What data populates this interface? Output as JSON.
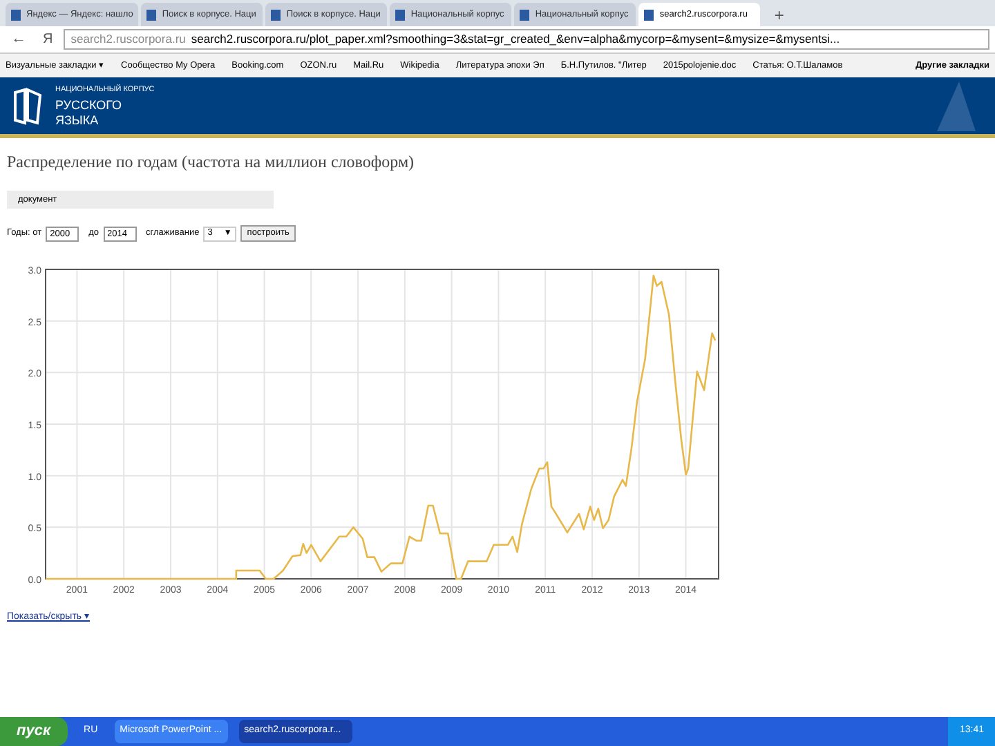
{
  "browser": {
    "tabs": [
      {
        "label": "Яндекс — Яндекс: нашло",
        "selected": false
      },
      {
        "label": "Поиск в корпусе. Наци",
        "selected": false
      },
      {
        "label": "Поиск в корпусе. Наци",
        "selected": false
      },
      {
        "label": "Национальный корпус",
        "selected": false
      },
      {
        "label": "Национальный корпус",
        "selected": false
      },
      {
        "label": "search2.ruscorpora.ru",
        "selected": true
      }
    ],
    "new_tab": "+",
    "back": "←",
    "yandex": "Я",
    "address": {
      "host": "search2.ruscorpora.ru",
      "url": "search2.ruscorpora.ru/plot_paper.xml?smoothing=3&stat=gr_created_&env=alpha&mycorp=&mysent=&mysize=&mysentsi..."
    },
    "bookmarks": [
      "Визуальные закладки ▾",
      "Сообщество My Opera",
      "Booking.com",
      "OZON.ru",
      "Mail.Ru",
      "Wikipedia",
      "Литература эпохи Эп",
      "Б.Н.Путилов. \"Литер",
      "2015polojenie.doc",
      "Статья: О.Т.Шаламов"
    ],
    "other_bookmarks": "Другие закладки"
  },
  "header": {
    "logo_lines": [
      "НАЦИОНАЛЬНЫЙ КОРПУС",
      "РУССКОГО",
      "ЯЗЫКА"
    ]
  },
  "page": {
    "title": "Распределение по годам (частота на миллион словоформ)",
    "section": "документ",
    "form": {
      "years_label": "Годы: от",
      "from": "2000",
      "to_label": "до",
      "to": "2014",
      "smoothing_label": "сглаживание",
      "smoothing": "3",
      "smoothing_caret": "▼",
      "submit": "построить"
    },
    "chart_data": {
      "type": "line",
      "xticks": [
        2001,
        2002,
        2003,
        2004,
        2005,
        2006,
        2007,
        2008,
        2009,
        2010,
        2011,
        2012,
        2013,
        2014
      ],
      "yticks": [
        {
          "value": 0,
          "label": "0.0"
        },
        0.5,
        {
          "value": 1,
          "label": "1.0"
        },
        1.5,
        {
          "value": 2,
          "label": "2.0"
        },
        2.5,
        {
          "value": 3,
          "label": "3.0"
        }
      ],
      "grid": true,
      "xlim": [
        2000.33,
        2014.7
      ],
      "ylim": [
        0,
        3
      ],
      "x": [
        2000.33,
        2004.4,
        2004.4,
        2004.9,
        2005.03,
        2005.2,
        2005.4,
        2005.6,
        2005.77,
        2005.83,
        2005.9,
        2006.0,
        2006.2,
        2006.6,
        2006.75,
        2006.9,
        2007.1,
        2007.2,
        2007.35,
        2007.5,
        2007.7,
        2007.95,
        2008.1,
        2008.25,
        2008.35,
        2008.5,
        2008.6,
        2008.75,
        2008.92,
        2009.1,
        2009.2,
        2009.35,
        2009.75,
        2009.9,
        2010.2,
        2010.3,
        2010.4,
        2010.5,
        2010.7,
        2010.87,
        2010.96,
        2011.04,
        2011.13,
        2011.23,
        2011.47,
        2011.72,
        2011.82,
        2011.96,
        2012.04,
        2012.13,
        2012.23,
        2012.35,
        2012.47,
        2012.65,
        2012.72,
        2012.84,
        2012.96,
        2013.13,
        2013.31,
        2013.38,
        2013.48,
        2013.64,
        2013.77,
        2013.9,
        2014.0,
        2014.05,
        2014.24,
        2014.39,
        2014.56,
        2014.63
      ],
      "series": [
        {
          "color": "#e8b84a",
          "values": [
            0,
            0,
            0.08,
            0.08,
            0,
            0,
            0.08,
            0.22,
            0.23,
            0.34,
            0.25,
            0.33,
            0.17,
            0.41,
            0.41,
            0.5,
            0.39,
            0.21,
            0.21,
            0.07,
            0.15,
            0.15,
            0.41,
            0.37,
            0.37,
            0.71,
            0.71,
            0.44,
            0.44,
            0,
            0,
            0.17,
            0.17,
            0.33,
            0.33,
            0.41,
            0.26,
            0.53,
            0.87,
            1.07,
            1.07,
            1.13,
            0.7,
            0.63,
            0.45,
            0.63,
            0.48,
            0.7,
            0.57,
            0.68,
            0.49,
            0.57,
            0.8,
            0.96,
            0.9,
            1.27,
            1.72,
            2.13,
            2.94,
            2.84,
            2.88,
            2.56,
            1.93,
            1.36,
            1.01,
            1.07,
            2.01,
            1.83,
            2.38,
            2.31
          ]
        }
      ]
    },
    "toggle_link": "Показать/скрыть ▾"
  },
  "taskbar": {
    "start": "пуск",
    "lang": "RU",
    "tasks": [
      {
        "label": "Microsoft PowerPoint ...",
        "selected": false
      },
      {
        "label": "search2.ruscorpora.r...",
        "selected": true
      }
    ],
    "time": "13:41"
  }
}
